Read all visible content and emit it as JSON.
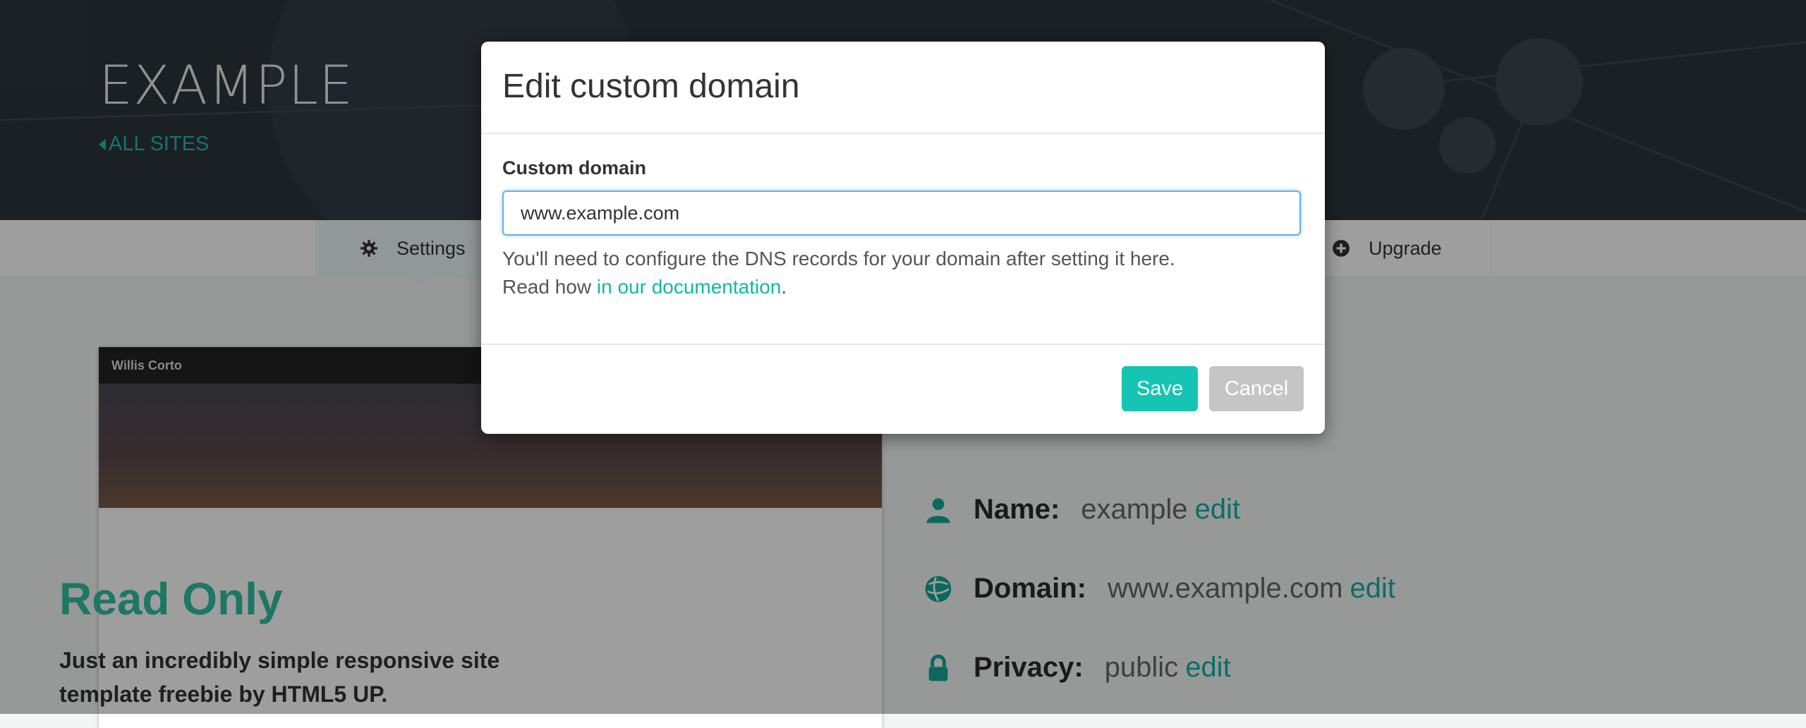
{
  "site": {
    "title": "EXAMPLE",
    "back_link": "ALL SITES"
  },
  "nav": {
    "settings_label": "Settings",
    "upgrade_label": "Upgrade"
  },
  "preview": {
    "author": "Willis Corto",
    "heading": "Read Only",
    "description": "Just an incredibly simple responsive site template freebie by HTML5 UP."
  },
  "info": {
    "name_label": "Name:",
    "name_value": "example",
    "domain_label": "Domain:",
    "domain_value": "www.example.com",
    "privacy_label": "Privacy:",
    "privacy_value": "public",
    "edit_label": "edit"
  },
  "modal": {
    "title": "Edit custom domain",
    "field_label": "Custom domain",
    "field_value": "www.example.com",
    "help_line1": "You'll need to configure the DNS records for your domain after setting it here.",
    "help_prefix": "Read how ",
    "help_link": "in our documentation",
    "help_suffix": ".",
    "save_label": "Save",
    "cancel_label": "Cancel"
  },
  "colors": {
    "accent": "#17c4b4",
    "header_bg": "#2c353d",
    "cancel_bg": "#c5c5c5",
    "focus_border": "#66afe9"
  },
  "icons": {
    "settings": "gear-icon",
    "upgrade": "plus-circle-icon",
    "name": "user-icon",
    "domain": "globe-icon",
    "privacy": "lock-icon",
    "back": "caret-left-icon"
  }
}
